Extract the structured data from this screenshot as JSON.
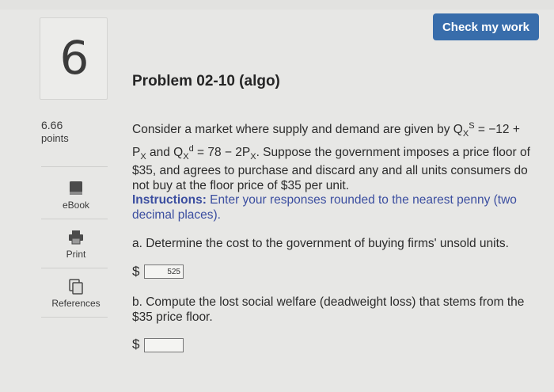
{
  "question": {
    "number": "6",
    "points_value": "6.66",
    "points_label": "points"
  },
  "header": {
    "check_button": "Check my work",
    "title": "Problem 02-10 (algo)"
  },
  "tools": {
    "ebook": "eBook",
    "print": "Print",
    "references": "References"
  },
  "problem": {
    "p1": "Consider a market where supply and demand are given by Q",
    "x1": "X",
    "s": "S",
    "p2": " = −12 +",
    "p3": "P",
    "x2": "X",
    "p4": " and Q",
    "x3": "X",
    "d": "d",
    "p5": " = 78 − 2P",
    "x4": "X",
    "p6": ". Suppose the government imposes a price floor of $35, and agrees to purchase and discard any and all units consumers do not buy at the floor price of $35 per unit.",
    "instr_label": "Instructions:",
    "instr_text": " Enter your responses rounded to the nearest penny (two decimal places)."
  },
  "part_a": {
    "question": "a. Determine the cost to the government of buying firms' unsold units.",
    "currency": "$",
    "answer": "525"
  },
  "part_b": {
    "question": "b. Compute the lost social welfare (deadweight loss) that stems from the $35 price floor.",
    "currency": "$",
    "answer": ""
  }
}
